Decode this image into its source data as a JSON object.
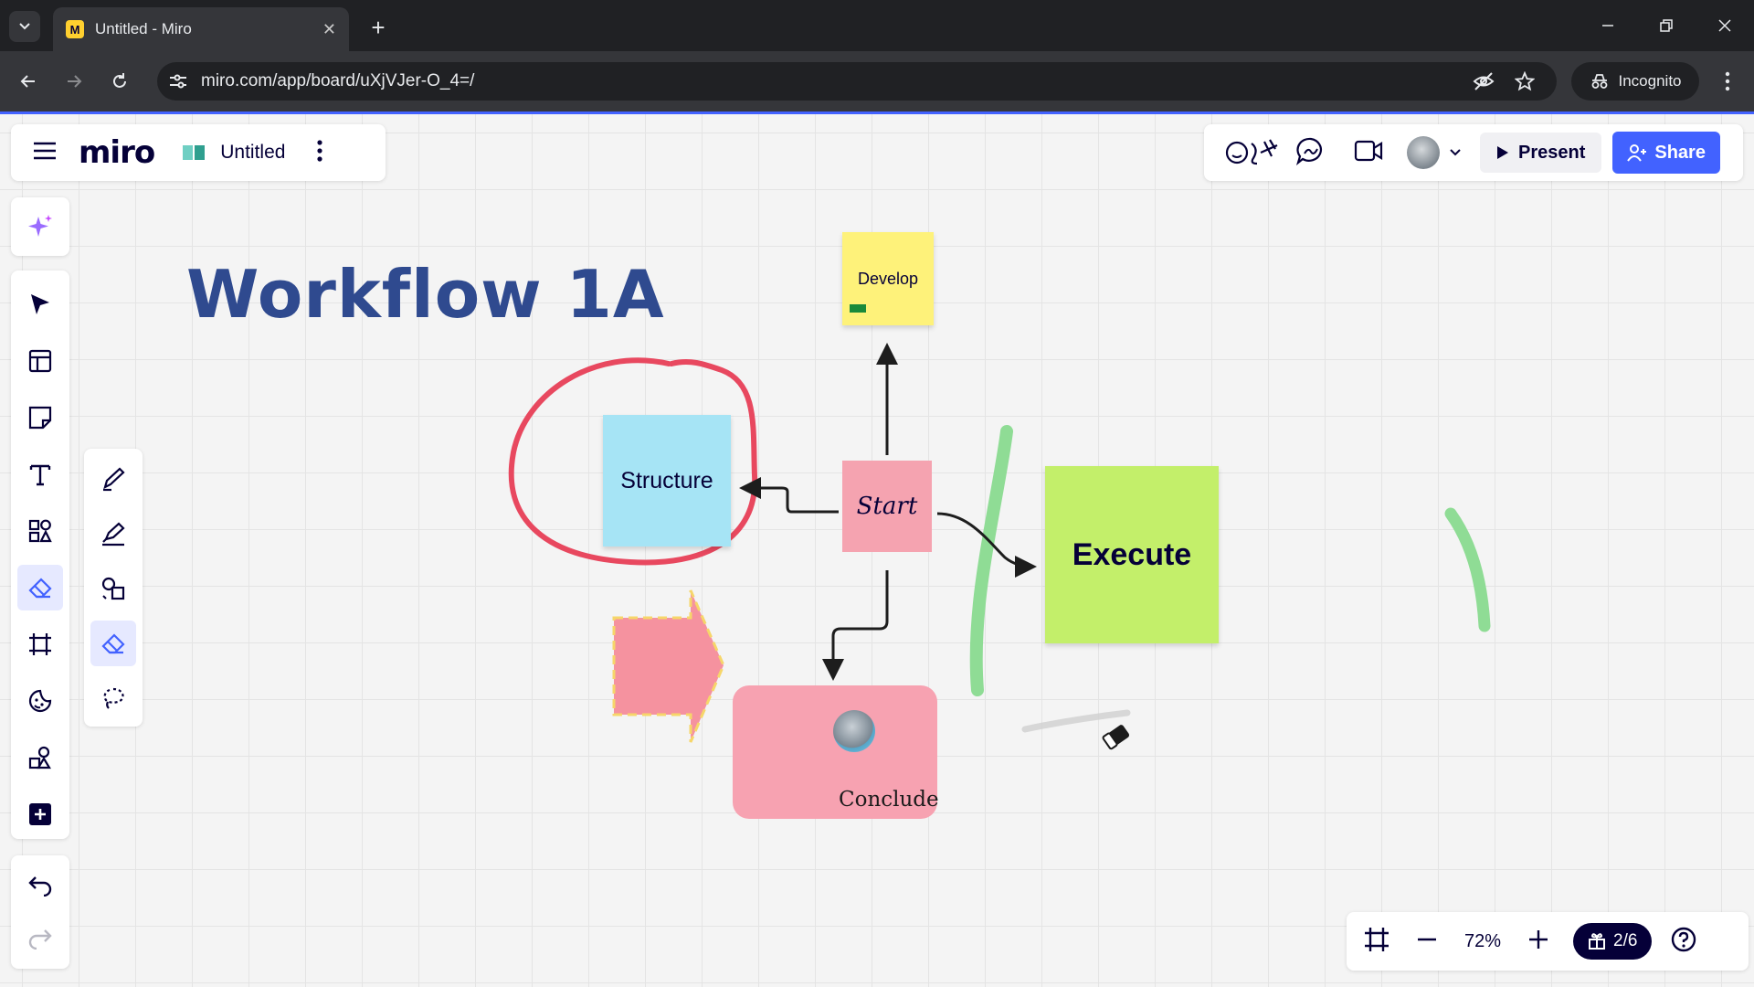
{
  "browser": {
    "tab_title": "Untitled - Miro",
    "url": "miro.com/app/board/uXjVJer-O_4=/",
    "incognito_label": "Incognito",
    "new_tab_symbol": "+"
  },
  "miro": {
    "brand": "miro",
    "board_title": "Untitled",
    "present_label": "Present",
    "share_label": "Share",
    "zoom_level": "72%",
    "pages": "2/6"
  },
  "canvas": {
    "title": "Workflow 1A",
    "stickies": {
      "develop": "Develop",
      "structure": "Structure",
      "start": "Start",
      "execute": "Execute",
      "conclude": "Conclude"
    }
  },
  "colors": {
    "accent": "#4262ff",
    "brand_dark": "#050038",
    "title_blue": "#2f4a8f",
    "sticky_yellow": "#fef27a",
    "sticky_cyan": "#a6e4f5",
    "sticky_pink": "#f5a3b0",
    "sticky_green": "#c3ef6a",
    "pen_red": "#e8485f",
    "pen_green": "#8fdc95"
  },
  "icons": {
    "left_toolbar": [
      "select-icon",
      "templates-icon",
      "sticky-note-icon",
      "text-icon",
      "shapes-icon",
      "pen-icon",
      "frame-icon",
      "sticker-icon",
      "apps-icon",
      "more-tools-icon"
    ],
    "pen_panel": [
      "pen-icon",
      "highlighter-icon",
      "smart-draw-icon",
      "eraser-icon",
      "lasso-icon"
    ]
  }
}
